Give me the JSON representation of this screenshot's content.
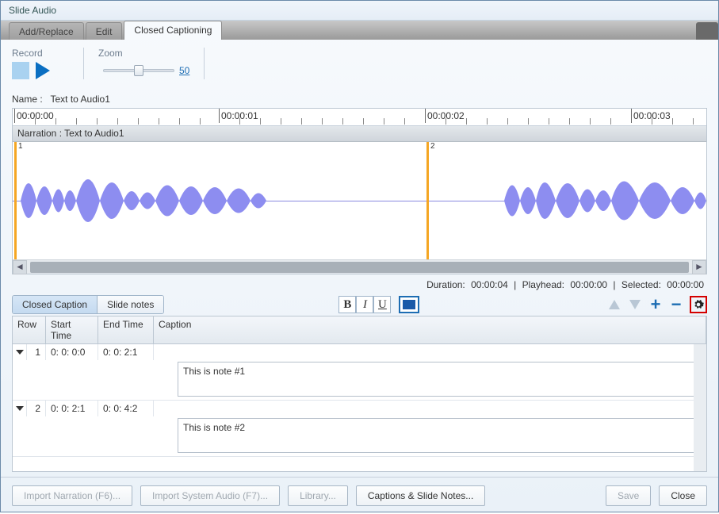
{
  "title": "Slide Audio",
  "tabs": {
    "add_replace": "Add/Replace",
    "edit": "Edit",
    "cc": "Closed Captioning"
  },
  "toolbar": {
    "record": "Record",
    "zoom": "Zoom",
    "zoom_value": "50"
  },
  "name_label": "Name :",
  "name_value": "Text to Audio1",
  "ruler": {
    "t0": "00:00:00",
    "t1": "00:00:01",
    "t2": "00:00:02",
    "t3": "00:00:03"
  },
  "narr_label": "Narration : Text to Audio1",
  "markers": {
    "m1": "1",
    "m2": "2"
  },
  "status": {
    "dur_l": "Duration:",
    "dur_v": "00:00:04",
    "play_l": "Playhead:",
    "play_v": "00:00:00",
    "sel_l": "Selected:",
    "sel_v": "00:00:00",
    "sep": "|"
  },
  "subtabs": {
    "cc": "Closed Caption",
    "sn": "Slide notes"
  },
  "grid_headers": {
    "row": "Row",
    "start": "Start Time",
    "end": "End Time",
    "caption": "Caption"
  },
  "rows": [
    {
      "idx": "1",
      "start": "0: 0: 0:0",
      "end": "0: 0: 2:1",
      "note": "This is note #1"
    },
    {
      "idx": "2",
      "start": "0: 0: 2:1",
      "end": "0: 0: 4:2",
      "note": "This is note #2"
    }
  ],
  "footer": {
    "imp_narr": "Import Narration (F6)...",
    "imp_sys": "Import System Audio (F7)...",
    "lib": "Library...",
    "csn": "Captions & Slide Notes...",
    "save": "Save",
    "close": "Close"
  }
}
